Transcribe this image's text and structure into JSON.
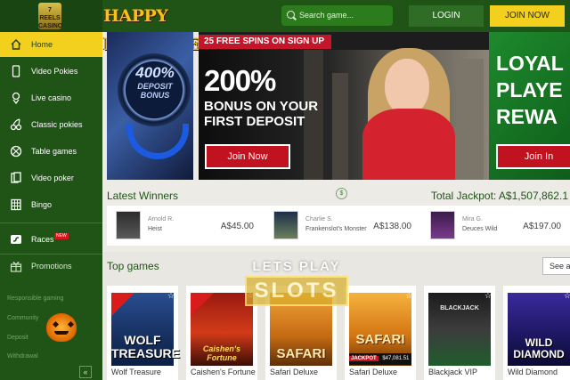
{
  "header": {
    "logo_text": "7 REELS CASINO",
    "halloween_text": "HAPPY HALLOWEEN",
    "search_placeholder": "Search game...",
    "login_label": "LOGIN",
    "join_label": "JOIN NOW"
  },
  "sidebar": {
    "items": [
      {
        "label": "Home",
        "icon": "home-icon"
      },
      {
        "label": "Video Pokies",
        "icon": "phone-icon"
      },
      {
        "label": "Live casino",
        "icon": "dealer-icon"
      },
      {
        "label": "Classic pokies",
        "icon": "cherries-icon"
      },
      {
        "label": "Table games",
        "icon": "roulette-icon"
      },
      {
        "label": "Video poker",
        "icon": "cards-icon"
      },
      {
        "label": "Bingo",
        "icon": "bingo-icon"
      },
      {
        "label": "Races",
        "icon": "races-icon"
      },
      {
        "label": "Promotions",
        "icon": "gift-icon"
      }
    ],
    "races_badge": "NEW",
    "footer_links": [
      "Responsible gaming",
      "Community",
      "Deposit",
      "Withdrawal"
    ],
    "collapse_label": "«"
  },
  "hero": {
    "left_big": "400%",
    "left_small": "DEPOSIT BONUS",
    "ribbon": "25 FREE SPINS ON SIGN UP",
    "headline": "200%",
    "subline1": "BONUS ON YOUR",
    "subline2": "FIRST DEPOSIT",
    "cta": "Join Now",
    "right_headline": "LOYAL\nPLAYE\nREWA",
    "right_cta": "Join In"
  },
  "winners": {
    "title": "Latest Winners",
    "jackpot_label": "Total Jackpot:",
    "jackpot_value": "A$1,507,862.1",
    "list": [
      {
        "name": "Arnold R.",
        "game": "Heist",
        "amount": "A$45.00"
      },
      {
        "name": "Charlie S.",
        "game": "Frankenslot's Monster",
        "amount": "A$138.00"
      },
      {
        "name": "Mira G.",
        "game": "Deuces Wild",
        "amount": "A$197.00"
      }
    ]
  },
  "games": {
    "title": "Top games",
    "see_all": "See al",
    "list": [
      {
        "title": "Wolf Treasure",
        "art": "WOLF TREASURE"
      },
      {
        "title": "Caishen's Fortune",
        "art": "Caishen's Fortune"
      },
      {
        "title": "Safari Deluxe",
        "art": "SAFARI"
      },
      {
        "title": "Safari Deluxe",
        "art": "SAFARI"
      },
      {
        "title": "Blackjack VIP",
        "art": "BLACKJACK"
      },
      {
        "title": "Wild Diamond",
        "art": "WILD DIAMOND"
      }
    ],
    "jackpot_badge_label": "JACKPOT",
    "jackpot_badge_value": "$47,081.51"
  },
  "watermark": {
    "top": "LETS PLAY",
    "bottom": "SLOTS"
  },
  "colors": {
    "brand_green": "#1f5416",
    "accent_yellow": "#f3cf1e",
    "promo_red": "#c1121f"
  }
}
